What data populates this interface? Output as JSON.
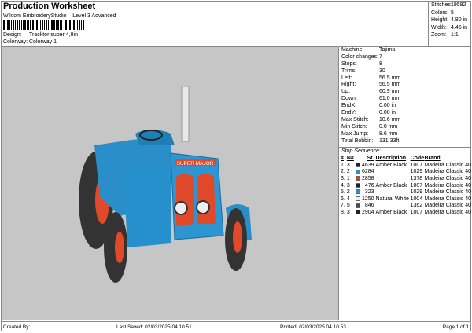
{
  "header": {
    "title": "Production Worksheet",
    "software": "Wilcom EmbroideryStudio – Level 3 Advanced",
    "design_label": "Design:",
    "design": "Tracktor super 4,8in",
    "colorway_label": "Colorway:",
    "colorway": "Colorway 1"
  },
  "stats": [
    {
      "k": "Stitches:",
      "v": "19582"
    },
    {
      "k": "Colors:",
      "v": "5"
    },
    {
      "k": "Height:",
      "v": "4.80 in"
    },
    {
      "k": "Width:",
      "v": "4.45 in"
    },
    {
      "k": "Zoom:",
      "v": "1:1"
    }
  ],
  "info": [
    {
      "k": "Machine:",
      "v": "Tajima"
    },
    {
      "k": "Color changes:",
      "v": "7"
    },
    {
      "k": "Stops:",
      "v": "8"
    },
    {
      "k": "Trims:",
      "v": "30"
    },
    {
      "k": "Left:",
      "v": "56.5 mm"
    },
    {
      "k": "Right:",
      "v": "56.5 mm"
    },
    {
      "k": "Up:",
      "v": "60.9 mm"
    },
    {
      "k": "Down:",
      "v": "61.0 mm"
    },
    {
      "k": "EndX:",
      "v": "0.00 in"
    },
    {
      "k": "EndY:",
      "v": "0.00 in"
    },
    {
      "k": "Max Stitch:",
      "v": "10.6 mm"
    },
    {
      "k": "Min Stitch:",
      "v": "0.0 mm"
    },
    {
      "k": "Max Jump:",
      "v": "8.6 mm"
    },
    {
      "k": "Total Bobbin:",
      "v": "131.33ft"
    }
  ],
  "stop_sequence": {
    "title": "Stop Sequence:",
    "columns": [
      "#",
      "N#",
      "St.",
      "Description",
      "Code",
      "Brand"
    ],
    "rows": [
      {
        "n": "1.",
        "nn": "3",
        "color": "#222222",
        "st": "4639",
        "desc": "Amber Black",
        "code": "1007",
        "brand": "Madeira Classic 40"
      },
      {
        "n": "2.",
        "nn": "2",
        "color": "#2b8fd0",
        "st": "6284",
        "desc": "",
        "code": "1029",
        "brand": "Madeira Classic 40"
      },
      {
        "n": "3.",
        "nn": "1",
        "color": "#e23a22",
        "st": "2858",
        "desc": "",
        "code": "1378",
        "brand": "Madeira Classic 40"
      },
      {
        "n": "4.",
        "nn": "3",
        "color": "#222222",
        "st": "476",
        "desc": "Amber Black",
        "code": "1007",
        "brand": "Madeira Classic 40"
      },
      {
        "n": "5.",
        "nn": "2",
        "color": "#2b8fd0",
        "st": "323",
        "desc": "",
        "code": "1029",
        "brand": "Madeira Classic 40"
      },
      {
        "n": "6.",
        "nn": "4",
        "color": "#eeeeee",
        "st": "1250",
        "desc": "Natural White",
        "code": "1004",
        "brand": "Madeira Classic 40"
      },
      {
        "n": "7.",
        "nn": "5",
        "color": "#4a4a55",
        "st": "846",
        "desc": "",
        "code": "1362",
        "brand": "Madeira Classic 40"
      },
      {
        "n": "8.",
        "nn": "3",
        "color": "#222222",
        "st": "2904",
        "desc": "Amber Black",
        "code": "1007",
        "brand": "Madeira Classic 40"
      }
    ]
  },
  "design_text": "SUPER MAJOR",
  "footer": {
    "created": "Created By:",
    "saved": "Last Saved: 02/03/2025 04.10.51",
    "printed": "Printed: 02/03/2025 04.10.53",
    "page": "Page 1 of 1"
  }
}
